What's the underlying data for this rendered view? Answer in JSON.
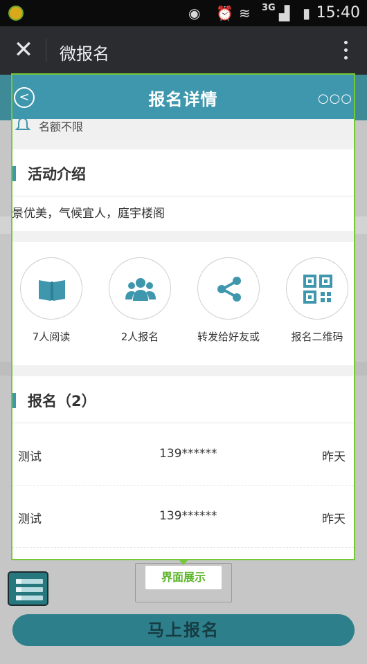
{
  "status_bar": {
    "time": "15:40",
    "network": "3G"
  },
  "wechat_bar": {
    "title": "微报名"
  },
  "header": {
    "title": "报名详情",
    "more": "○○○",
    "back": "<"
  },
  "quota": {
    "text": "名额不限"
  },
  "intro": {
    "heading": "活动介绍",
    "text": "风景优美，气候宜人，庭宇楼阁"
  },
  "actions": [
    {
      "label": "7人阅读",
      "icon": "book-icon"
    },
    {
      "label": "2人报名",
      "icon": "people-icon"
    },
    {
      "label": "转发给好友或",
      "icon": "share-icon"
    },
    {
      "label": "报名二维码",
      "icon": "qrcode-icon"
    }
  ],
  "registrations": {
    "heading": "报名（2）",
    "rows": [
      {
        "name": "测试",
        "phone": "139******",
        "date": "昨天"
      },
      {
        "name": "测试",
        "phone": "139******",
        "date": "昨天"
      }
    ]
  },
  "footer": {
    "signup_label": "马上报名",
    "badge": "界面展示"
  },
  "colors": {
    "accent": "#3f97ad",
    "frame": "#75c837",
    "statusbar": "#0b0b0b",
    "wechat_bar": "#2b2c30"
  }
}
